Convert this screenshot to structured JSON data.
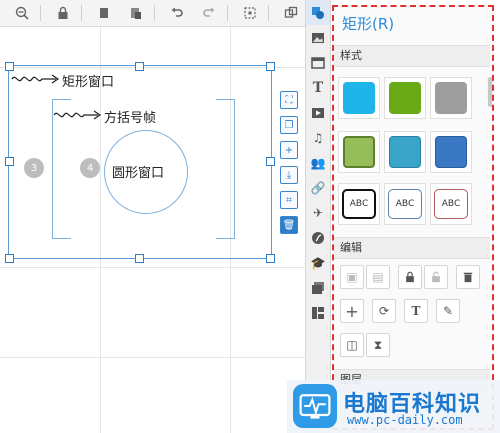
{
  "panel": {
    "title": "矩形(R)",
    "sections": {
      "style": "样式",
      "edit": "编辑",
      "layers": "图层"
    },
    "swatches": [
      {
        "color": "#1fb5e8",
        "border": "none"
      },
      {
        "color": "#6aa916",
        "border": "none"
      },
      {
        "color": "#9e9e9e",
        "border": "none"
      },
      {
        "color": "#95bd5a",
        "border": "#5f7f2c"
      },
      {
        "color": "#3ba4c9",
        "border": "#2a82a4"
      },
      {
        "color": "#3b78c3",
        "border": "#285b99"
      }
    ],
    "text_styles": [
      {
        "label": "ABC",
        "border": "#111111"
      },
      {
        "label": "ABC",
        "border": "#5e7fa8"
      },
      {
        "label": "ABC",
        "border": "#b25c5c"
      }
    ]
  },
  "canvas": {
    "label_rect": "矩形窗口",
    "label_bracket": "方括号帧",
    "label_circle": "圆形窗口",
    "marker_3": "3",
    "marker_4": "4"
  },
  "watermark": {
    "title": "电脑百科知识",
    "url": "www.pc-daily.com"
  },
  "colors": {
    "accent": "#2d8ad6",
    "selection": "#5b9bd5",
    "highlight_border": "#e03030"
  }
}
